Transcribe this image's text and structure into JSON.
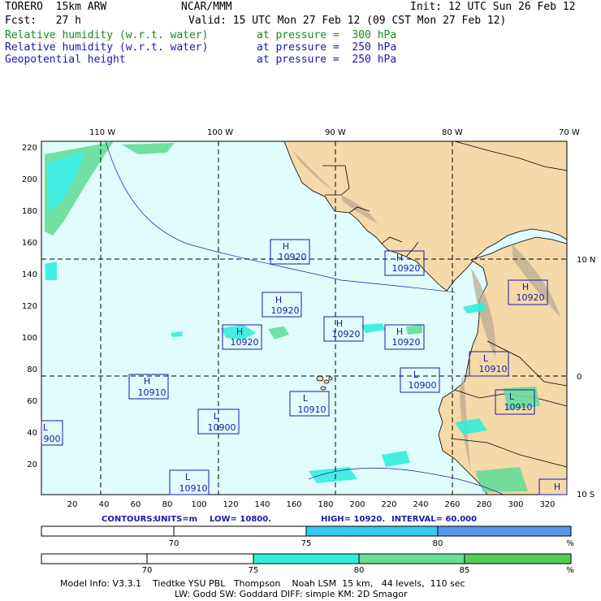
{
  "header": {
    "model": "TORERO  15km ARW",
    "org": "NCAR/MMM",
    "init": "Init: 12 UTC Sun 26 Feb 12",
    "fcst": "Fcst:   27 h",
    "valid": "Valid: 15 UTC Mon 27 Feb 12 (09 CST Mon 27 Feb 12)",
    "fields": [
      {
        "name": "Relative humidity (w.r.t. water)",
        "level": "at pressure =  300 hPa",
        "color": "#1a8a1a"
      },
      {
        "name": "Relative humidity (w.r.t. water)",
        "level": "at pressure =  250 hPa",
        "color": "#1a1aaa"
      },
      {
        "name": "Geopotential height",
        "level": "at pressure =  250 hPa",
        "color": "#1a1aaa"
      }
    ]
  },
  "map": {
    "lon_labels": [
      "110 W",
      "100 W",
      "90 W",
      "80 W",
      "70 W"
    ],
    "lat_labels": [
      "10 N",
      "0",
      "10 S"
    ],
    "y_ticks": [
      "220",
      "200",
      "180",
      "160",
      "140",
      "120",
      "100",
      "80",
      "60",
      "40",
      "20"
    ],
    "x_ticks": [
      "20",
      "40",
      "60",
      "80",
      "100",
      "120",
      "140",
      "160",
      "180",
      "200",
      "220",
      "240",
      "260",
      "280",
      "300",
      "320"
    ],
    "ocean_color": "#e0fcfc",
    "land_color": "#f5d9a8",
    "centers": [
      {
        "type": "H",
        "value": "10920"
      },
      {
        "type": "H",
        "value": "10920"
      },
      {
        "type": "H",
        "value": "10920"
      },
      {
        "type": "H",
        "value": "10920"
      },
      {
        "type": "H",
        "value": "10920"
      },
      {
        "type": "H",
        "value": "10920"
      },
      {
        "type": "H",
        "value": "10920"
      },
      {
        "type": "H",
        "value": "10910"
      },
      {
        "type": "L",
        "value": "10910"
      },
      {
        "type": "L",
        "value": "10900"
      },
      {
        "type": "L",
        "value": "10900"
      },
      {
        "type": "L",
        "value": "10910"
      },
      {
        "type": "L",
        "value": "10910"
      },
      {
        "type": "L",
        "value": "10910"
      },
      {
        "type": "L",
        "value": "900"
      },
      {
        "type": "H",
        "value": ""
      }
    ]
  },
  "contour_info": {
    "contours": "CONTOURS:",
    "units": "UNITS=m",
    "low": "LOW=  10800.",
    "high": "HIGH=  10920.",
    "interval": "INTERVAL=    60.000"
  },
  "colorbar_250": {
    "labels": [
      "70",
      "75",
      "80",
      "%"
    ],
    "colors": [
      "#ffffff",
      "#33ccee",
      "#5599ee"
    ]
  },
  "colorbar_300": {
    "labels": [
      "70",
      "75",
      "80",
      "85",
      "%"
    ],
    "colors": [
      "#ffffff",
      "#33eedd",
      "#55ddaa",
      "#66cc88",
      "#55cc55"
    ]
  },
  "footer": {
    "line1": "Model Info: V3.3.1    Tiedtke YSU PBL   Thompson    Noah LSM  15 km,   44 levels,  110 sec",
    "line2": "LW: Godd SW: Goddard DIFF: simple KM: 2D Smagor"
  }
}
